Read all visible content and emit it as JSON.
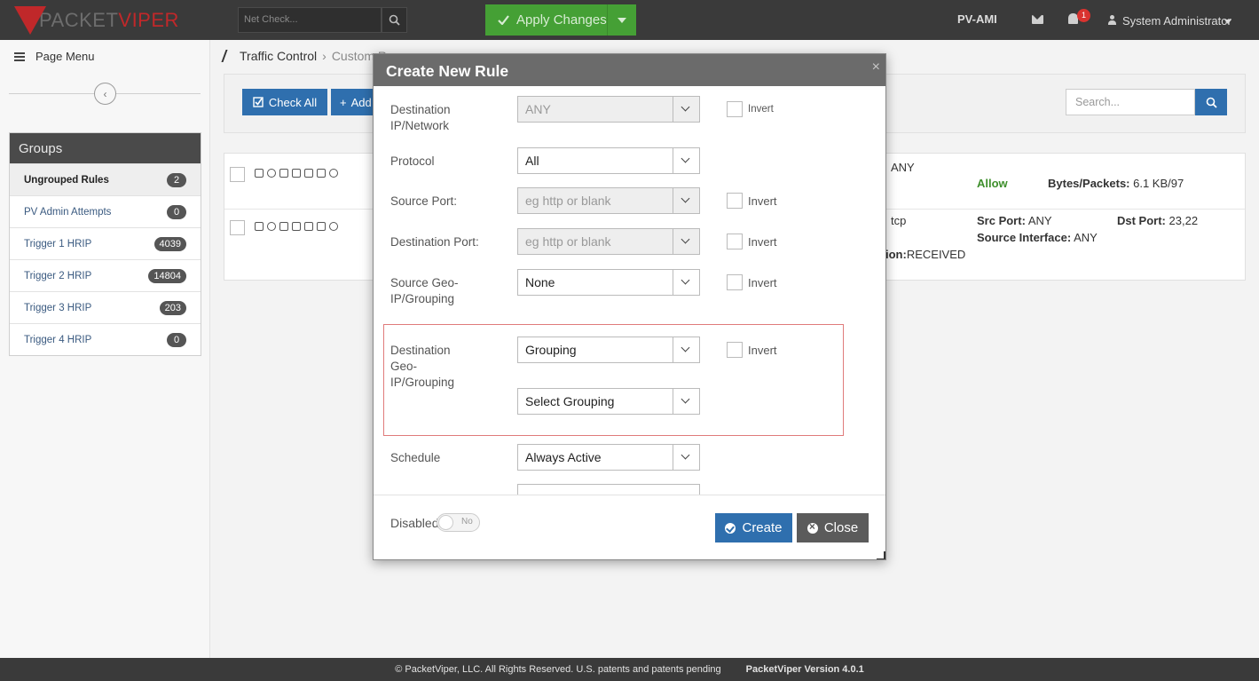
{
  "topbar": {
    "logo_part1": "PACKET",
    "logo_part2": "VIPER",
    "netcheck_placeholder": "Net Check...",
    "apply_label": "Apply Changes",
    "device": "PV-AMI",
    "notification_count": "1",
    "user": "System Administrator"
  },
  "sidebar": {
    "page_menu": "Page Menu",
    "groups_title": "Groups",
    "groups": [
      {
        "label": "Ungrouped Rules",
        "count": "2"
      },
      {
        "label": "PV Admin Attempts",
        "count": "0"
      },
      {
        "label": "Trigger 1 HRIP",
        "count": "4039"
      },
      {
        "label": "Trigger 2 HRIP",
        "count": "14804"
      },
      {
        "label": "Trigger 3 HRIP",
        "count": "203"
      },
      {
        "label": "Trigger 4 HRIP",
        "count": "0"
      }
    ]
  },
  "main": {
    "breadcrumb": [
      "Traffic Control",
      "Custom R"
    ],
    "check_all": "Check All",
    "add_label": "Add",
    "search_placeholder": "Search...",
    "rows": [
      {
        "dst_any": "ANY",
        "action": "Allow",
        "bytes_label": "Bytes/Packets:",
        "bytes_value": "6.1 KB/97"
      },
      {
        "proto": "tcp",
        "src_port_label": "Src Port:",
        "src_port_value": "ANY",
        "dst_port_label": "Dst Port:",
        "dst_port_value": "23,22",
        "src_iface_label": "Source Interface:",
        "src_iface_value": "ANY",
        "direction_label": "ion:",
        "direction_value": "RECEIVED"
      }
    ]
  },
  "modal": {
    "title": "Create New Rule",
    "fields": {
      "dest_ip_label": "Destination IP/Network",
      "dest_ip_value": "ANY",
      "protocol_label": "Protocol",
      "protocol_value": "All",
      "source_port_label": "Source Port:",
      "source_port_placeholder": "eg http or blank",
      "dest_port_label": "Destination Port:",
      "dest_port_placeholder": "eg http or blank",
      "source_geo_label": "Source Geo-IP/Grouping",
      "source_geo_value": "None",
      "dest_geo_label": "Destination Geo-IP/Grouping",
      "dest_geo_value": "Grouping",
      "select_grouping": "Select Grouping",
      "schedule_label": "Schedule",
      "schedule_value": "Always Active",
      "invert_label": "Invert"
    },
    "disabled_label": "Disabled",
    "toggle_value": "No",
    "create_label": "Create",
    "close_label": "Close"
  },
  "footer": {
    "copyright": "© PacketViper, LLC. All Rights Reserved. U.S. patents and patents pending",
    "version": "PacketViper Version 4.0.1"
  }
}
